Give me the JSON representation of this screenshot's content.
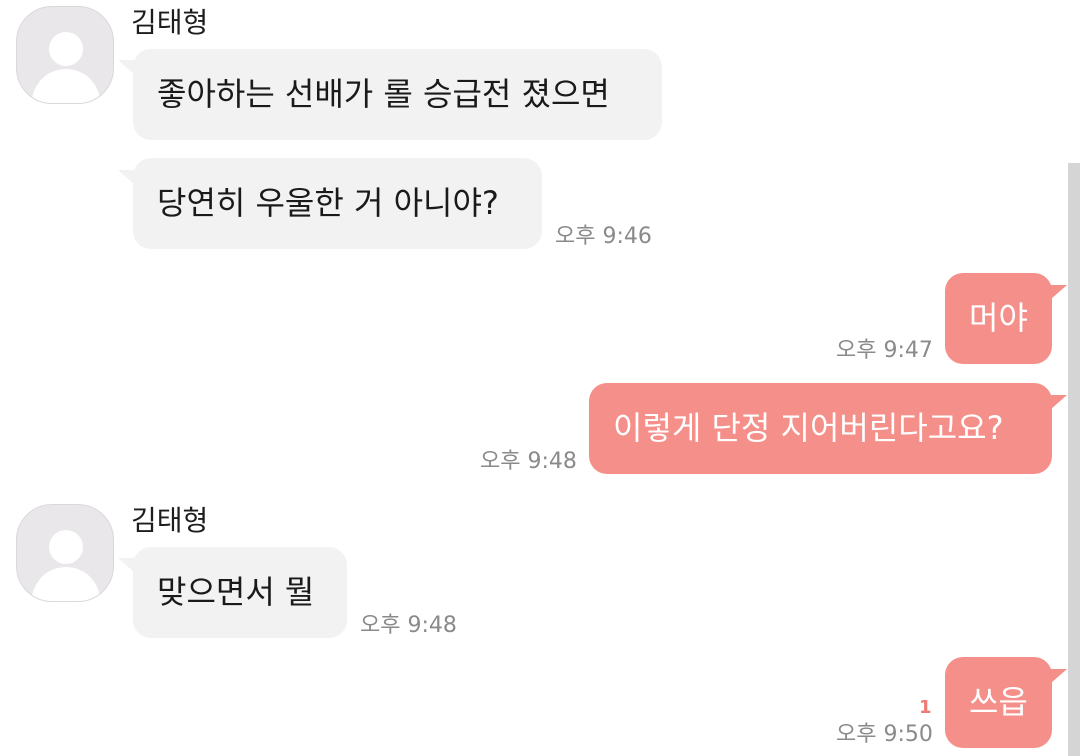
{
  "colors": {
    "incoming_bubble": "#f2f2f2",
    "outgoing_bubble": "#f58f8a",
    "timestamp": "#8a8a8a",
    "unread": "#f07a74"
  },
  "messages": [
    {
      "sender": "김태형",
      "text": "좋아하는 선배가 롤 승급전 졌으면"
    },
    {
      "text": "당연히 우울한 거 아니야?",
      "time": "오후 9:46"
    },
    {
      "text": "머야",
      "time": "오후 9:47"
    },
    {
      "text": "이렇게 단정 지어버린다고요?",
      "time": "오후 9:48"
    },
    {
      "sender": "김태형",
      "text": "맞으면서 뭘",
      "time": "오후 9:48"
    },
    {
      "text": "쓰읍",
      "time": "오후 9:50",
      "unread": "1"
    }
  ],
  "icons": {
    "avatar": "default-profile-icon"
  }
}
